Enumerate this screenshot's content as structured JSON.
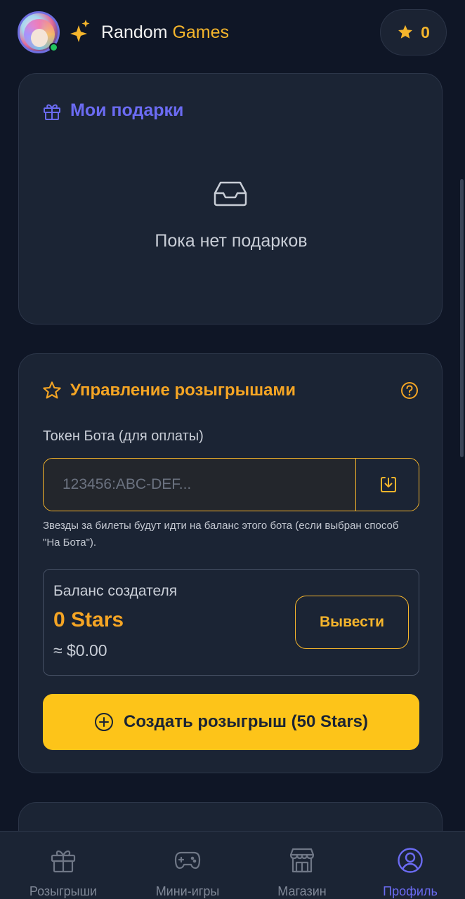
{
  "header": {
    "title_main": "Random",
    "title_accent": "Games",
    "star_count": "0",
    "avatar": "user-avatar",
    "sparkle_icon": "sparkle-icon",
    "star_icon": "star-icon"
  },
  "gifts_card": {
    "title": "Мои подарки",
    "icon": "gift-icon",
    "empty_icon": "inbox-tray-icon",
    "empty_text": "Пока нет подарков"
  },
  "manage_card": {
    "title": "Управление розыгрышами",
    "icon": "star-outline-icon",
    "help_icon": "question-circle-icon",
    "token_label": "Токен Бота (для оплаты)",
    "token_placeholder": "123456:ABC-DEF...",
    "token_value": "",
    "paste_icon": "download-box-icon",
    "token_hint": "Звезды за билеты будут идти на баланс этого бота (если выбран способ \"На Бота\").",
    "balance_label": "Баланс создателя",
    "balance_value": "0 Stars",
    "balance_usd": "≈ $0.00",
    "withdraw_label": "Вывести",
    "create_icon": "plus-circle-icon",
    "create_label": "Создать розыгрыш (50 Stars)"
  },
  "bottom_nav": {
    "items": [
      {
        "label": "Розыгрыши",
        "icon": "gift-icon",
        "active": false
      },
      {
        "label": "Мини-игры",
        "icon": "gamepad-icon",
        "active": false
      },
      {
        "label": "Магазин",
        "icon": "store-icon",
        "active": false
      },
      {
        "label": "Профиль",
        "icon": "user-circle-icon",
        "active": true
      }
    ]
  },
  "colors": {
    "background": "#0f1626",
    "card": "#1b2434",
    "accent_orange": "#f5a524",
    "accent_yellow": "#fdc419",
    "accent_purple": "#6b6bf2",
    "online_green": "#22c55e"
  }
}
